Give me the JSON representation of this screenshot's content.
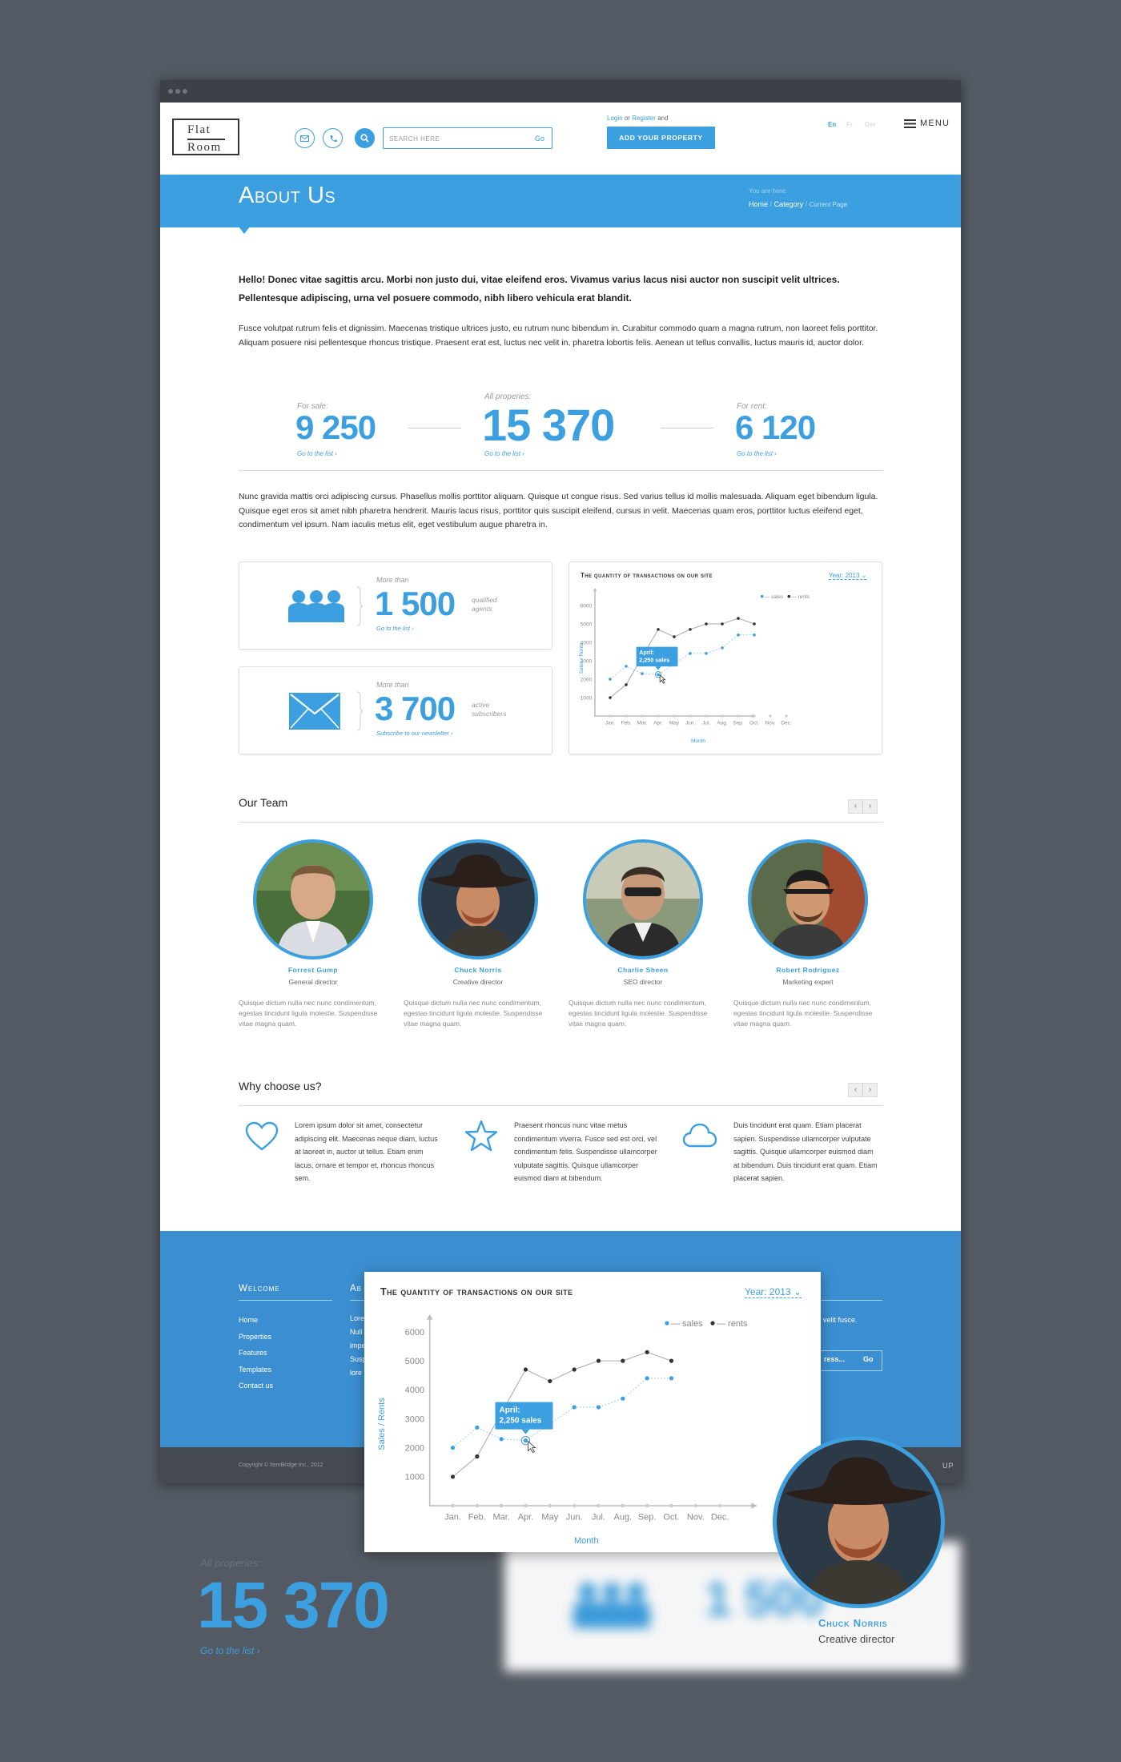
{
  "header": {
    "logo_line1": "Flat",
    "logo_line2": "Room",
    "search_placeholder": "Search here",
    "search_go": "Go",
    "login_text": "Login",
    "or_text": "or",
    "register_text": "Register",
    "and_text": "and",
    "add_property": "Add Your Property",
    "langs": [
      "En",
      "Fr",
      "Ger"
    ],
    "menu_label": "Menu",
    "colors": {
      "accent": "#3b9fe0",
      "footer": "#3b8fd1"
    }
  },
  "banner": {
    "title": "About Us",
    "you_are_here": "You are here:",
    "crumbs": [
      "Home",
      "Category",
      "Current Page"
    ],
    "separator": "/"
  },
  "content": {
    "lead": "Hello! Donec vitae sagittis arcu. Morbi non justo dui, vitae eleifend eros. Vivamus varius lacus nisi auctor non suscipit velit ultrices. Pellentesque adipiscing, urna vel posuere commodo, nibh libero vehicula erat blandit.",
    "para1": "Fusce volutpat rutrum felis et dignissim. Maecenas tristique ultrices justo, eu rutrum nunc bibendum in. Curabitur commodo quam a magna rutrum, non laoreet felis porttitor. Aliquam posuere nisi pellentesque rhoncus tristique. Praesent erat est, luctus nec velit in, pharetra lobortis felis. Aenean ut tellus convallis, luctus mauris id, auctor dolor.",
    "para2": "Nunc gravida mattis orci adipiscing cursus. Phasellus mollis porttitor aliquam. Quisque ut congue risus. Sed varius tellus id mollis malesuada. Aliquam eget bibendum ligula. Quisque eget eros sit amet nibh pharetra hendrerit. Mauris lacus risus, porttitor quis suscipit eleifend, cursus in velit. Maecenas quam eros, porttitor luctus eleifend eget, condimentum vel ipsum. Nam iaculis metus elit, eget vestibulum augue pharetra in."
  },
  "stats": {
    "for_sale": {
      "label": "For sale:",
      "value": "9 250",
      "link": "Go to the list"
    },
    "all": {
      "label": "All properies:",
      "value": "15 370",
      "link": "Go to the list"
    },
    "for_rent": {
      "label": "For rent:",
      "value": "6 120",
      "link": "Go to the list"
    }
  },
  "agents_box": {
    "more_than": "More than",
    "value": "1 500",
    "sub1": "qualified",
    "sub2": "agents",
    "link": "Go to the list",
    "icon": "people-icon"
  },
  "subscribers_box": {
    "more_than": "More than",
    "value": "3 700",
    "sub1": "active",
    "sub2": "subscribers",
    "link": "Subscribe to our newsletter",
    "icon": "envelope-icon"
  },
  "chart_widget": {
    "year_label": "Year: 2013",
    "tooltip_line1": "April:",
    "tooltip_line2": "2,250 sales"
  },
  "chart_data": {
    "type": "line",
    "title": "The quantity of transactions on our site",
    "xlabel": "Month",
    "ylabel": "Sales / Rents",
    "categories": [
      "Jan.",
      "Feb.",
      "Mar.",
      "Apr.",
      "May",
      "Jun.",
      "Jul.",
      "Aug.",
      "Sep.",
      "Oct.",
      "Nov.",
      "Dec."
    ],
    "yticks": [
      1000,
      2000,
      3000,
      4000,
      5000,
      6000
    ],
    "ylim": [
      0,
      6600
    ],
    "series": [
      {
        "name": "sales",
        "color": "#3b9fe0",
        "values": [
          2000,
          2700,
          2300,
          2250,
          null,
          3400,
          3400,
          3700,
          4400,
          4400,
          null,
          null
        ]
      },
      {
        "name": "rents",
        "color": "#333333",
        "values": [
          1000,
          1700,
          null,
          4700,
          4300,
          4700,
          5000,
          5000,
          5300,
          5000,
          null,
          null
        ]
      }
    ],
    "legend": "top-right"
  },
  "team": {
    "title": "Our Team",
    "members": [
      {
        "name": "Forrest Gump",
        "role": "General director",
        "desc": "Quisque dictum nulla nec nunc condimentum, egestas tincidunt ligula molestie. Suspendisse vitae magna quam."
      },
      {
        "name": "Chuck Norris",
        "role": "Creative director",
        "desc": "Quisque dictum nulla nec nunc condimentum, egestas tincidunt ligula molestie. Suspendisse vitae magna quam."
      },
      {
        "name": "Charlie Sheen",
        "role": "SEO director",
        "desc": "Quisque dictum nulla nec nunc condimentum, egestas tincidunt ligula molestie. Suspendisse vitae magna quam."
      },
      {
        "name": "Robert Rodriguez",
        "role": "Marketing expert",
        "desc": "Quisque dictum nulla nec nunc condimentum, egestas tincidunt ligula molestie. Suspendisse vitae magna quam."
      }
    ]
  },
  "why": {
    "title": "Why choose us?",
    "items": [
      {
        "icon": "heart-icon",
        "text": "Lorem ipsum dolor sit amet, consectetur adipiscing elit. Maecenas neque diam, luctus at laoreet in, auctor ut tellus. Etiam enim lacus, ornare et tempor et, rhoncus rhoncus sem."
      },
      {
        "icon": "star-icon",
        "text": "Praesent rhoncus nunc vitae metus condimentum viverra. Fusce sed est orci, vel condimentum felis. Suspendisse ullamcorper vulputate sagittis. Quisque ullamcorper euismod diam at bibendum."
      },
      {
        "icon": "cloud-icon",
        "text": "Duis tincidunt erat quam. Etiam placerat sapien. Suspendisse ullamcorper vulputate sagittis. Quisque ullamcorper euismod diam at bibendum. Duis tincidunt erat quam. Etiam placerat sapien."
      }
    ]
  },
  "footer": {
    "welcome": "Welcome",
    "links": [
      "Home",
      "Properties",
      "Features",
      "Templates",
      "Contact us"
    ],
    "about_partial": "Ab",
    "about_lines": [
      "Lore",
      "Null",
      "impe",
      "Susp",
      "lore"
    ],
    "right_text": "velit fusce.",
    "email_partial": "ress...",
    "email_go": "Go",
    "copyright": "Copyright © ItemBridge Inc., 2012",
    "up": "Up"
  },
  "callouts": {
    "stat_label": "All properies:",
    "stat_value": "15 370",
    "stat_link": "Go to the list",
    "person_name": "Chuck Norris",
    "person_role": "Creative director",
    "blur_value": "1 500"
  }
}
